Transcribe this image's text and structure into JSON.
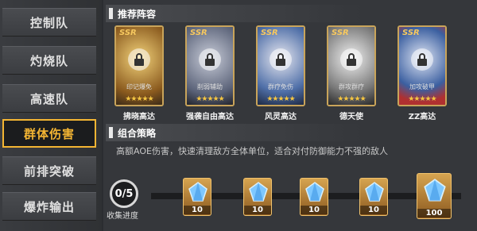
{
  "tabs": [
    {
      "label": "控制队",
      "active": false
    },
    {
      "label": "灼烧队",
      "active": false
    },
    {
      "label": "高速队",
      "active": false
    },
    {
      "label": "群体伤害",
      "active": true
    },
    {
      "label": "前排突破",
      "active": false
    },
    {
      "label": "爆炸输出",
      "active": false
    }
  ],
  "recommended": {
    "title": "推荐阵容",
    "cards": [
      {
        "rarity": "SSR",
        "tag": "印记爆免",
        "name": "拂晓高达",
        "stars": "★★★★★"
      },
      {
        "rarity": "SSR",
        "tag": "削弱辅助",
        "name": "强袭自由高达",
        "stars": "★★★★★"
      },
      {
        "rarity": "SSR",
        "tag": "群疗免伤",
        "name": "风灵高达",
        "stars": "★★★★★"
      },
      {
        "rarity": "SSR",
        "tag": "群攻群疗",
        "name": "德天使",
        "stars": "★★★★★"
      },
      {
        "rarity": "SSR",
        "tag": "加攻破甲",
        "name": "ZZ高达",
        "stars": "★★★★★"
      }
    ]
  },
  "strategy": {
    "title": "组合策略",
    "text": "高额AOE伤害，快速清理敌方全体单位，适合对付防御能力不强的敌人"
  },
  "progress": {
    "value": "0/5",
    "label": "收集进度",
    "rewards": [
      {
        "count": "10"
      },
      {
        "count": "10"
      },
      {
        "count": "10"
      },
      {
        "count": "10"
      },
      {
        "count": "100"
      }
    ]
  },
  "colors": {
    "accent": "#f4b533",
    "card_border": "#c9a45a",
    "star": "#f4c542"
  }
}
